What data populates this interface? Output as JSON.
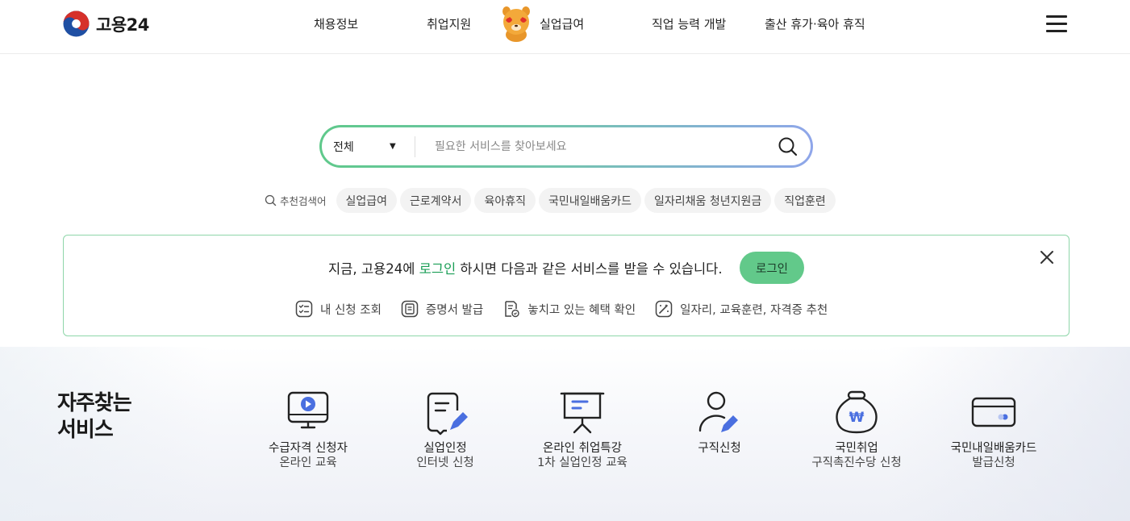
{
  "header": {
    "logo_text": "고용24",
    "nav": [
      {
        "label": "채용정보"
      },
      {
        "label": "취업지원"
      },
      {
        "label": "실업급여"
      },
      {
        "label": "직업 능력 개발"
      },
      {
        "label": "출산 휴가·육아 휴직"
      }
    ],
    "menu_icon": "hamburger-icon"
  },
  "search": {
    "scope_selected": "전체",
    "placeholder": "필요한 서비스를 찾아보세요",
    "value": ""
  },
  "recommend": {
    "label": "추천검색어",
    "keywords": [
      "실업급여",
      "근로계약서",
      "육아휴직",
      "국민내일배움카드",
      "일자리채움 청년지원금",
      "직업훈련"
    ]
  },
  "login_banner": {
    "msg_prefix": "지금, 고용24에 ",
    "msg_highlight": "로그인",
    "msg_suffix": " 하시면 다음과 같은 서비스를 받을 수 있습니다.",
    "button_label": "로그인",
    "features": [
      {
        "label": "내 신청 조회",
        "icon": "checklist-icon"
      },
      {
        "label": "증명서 발급",
        "icon": "certificate-icon"
      },
      {
        "label": "놓치고 있는 혜택 확인",
        "icon": "benefit-doc-icon"
      },
      {
        "label": "일자리, 교육훈련, 자격증 추천",
        "icon": "magic-wand-icon"
      }
    ]
  },
  "services": {
    "title": "자주찾는\n서비스",
    "items": [
      {
        "line1": "수급자격 신청자",
        "line2": "온라인 교육",
        "icon": "video-monitor-icon"
      },
      {
        "line1": "실업인정",
        "line2": "인터넷 신청",
        "icon": "document-pen-icon"
      },
      {
        "line1": "온라인 취업특강",
        "line2": "1차 실업인정 교육",
        "icon": "presentation-board-icon"
      },
      {
        "line1": "구직신청",
        "line2": "",
        "icon": "person-pen-icon"
      },
      {
        "line1": "국민취업",
        "line2": "구직촉진수당 신청",
        "icon": "money-bag-icon"
      },
      {
        "line1": "국민내일배움카드",
        "line2": "발급신청",
        "icon": "card-icon"
      }
    ]
  },
  "colors": {
    "accent_green": "#62c98a",
    "highlight_green": "#1a9e56",
    "icon_blue": "#4a6fe0",
    "banner_border": "#8ed6a9"
  }
}
